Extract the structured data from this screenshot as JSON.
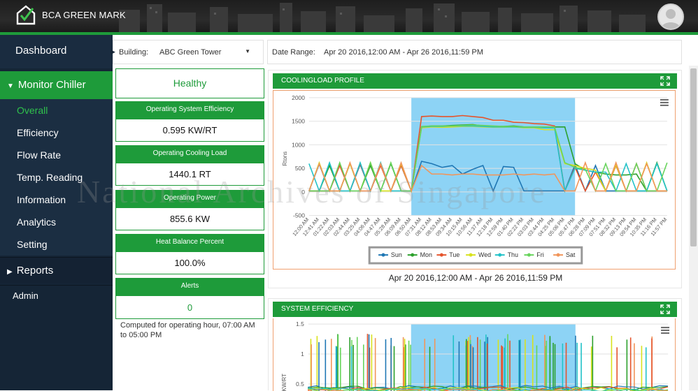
{
  "app": {
    "brand": "BCA GREEN MARK"
  },
  "sidebar": {
    "dashboard": "Dashboard",
    "monitor": "Monitor Chiller",
    "items": [
      {
        "label": "Overall",
        "active": true
      },
      {
        "label": "Efficiency"
      },
      {
        "label": "Flow Rate"
      },
      {
        "label": "Temp. Reading"
      },
      {
        "label": "Information"
      },
      {
        "label": "Analytics"
      },
      {
        "label": "Setting"
      }
    ],
    "reports": "Reports",
    "admin": "Admin"
  },
  "filters": {
    "building_label": "Building:",
    "building_value": "ABC Green Tower",
    "date_label": "Date Range:",
    "date_value": "Apr 20 2016,12:00 AM - Apr 26 2016,11:59 PM"
  },
  "kpi": {
    "status": "Healthy",
    "efficiency_label": "Operating System Efficiency",
    "efficiency_value": "0.595 KW/RT",
    "cooling_label": "Operating Cooling Load",
    "cooling_value": "1440.1 RT",
    "power_label": "Operating Power",
    "power_value": "855.6 KW",
    "heat_label": "Heat Balance Percent",
    "heat_value": "100.0%",
    "alerts_label": "Alerts",
    "alerts_value": "0",
    "note": "Computed for operating hour, 07:00 AM to 05:00 PM"
  },
  "watermark": "National Archives of Singapore",
  "chart_data": [
    {
      "type": "line",
      "title": "COOLINGLOAD PROFILE",
      "ylabel": "Rtons",
      "ylim": [
        -500,
        2000
      ],
      "yticks": [
        "2000",
        "1500",
        "1000",
        "500",
        "0",
        "-500"
      ],
      "xticks": [
        "12:00 AM",
        "12:41 AM",
        "01:22 AM",
        "02:03 AM",
        "02:44 AM",
        "03:25 AM",
        "04:06 AM",
        "04:47 AM",
        "05:28 AM",
        "06:09 AM",
        "06:50 AM",
        "07:31 AM",
        "08:12 AM",
        "08:53 AM",
        "09:34 AM",
        "10:15 AM",
        "10:56 AM",
        "11:37 AM",
        "12:18 PM",
        "12:59 PM",
        "01:40 PM",
        "02:22 PM",
        "03:03 PM",
        "03:44 PM",
        "04:25 PM",
        "05:06 PM",
        "05:47 PM",
        "06:28 PM",
        "07:09 PM",
        "07:51 PM",
        "08:32 PM",
        "09:13 PM",
        "09:54 PM",
        "10:35 PM",
        "11:16 PM",
        "11:57 PM"
      ],
      "highlight_band": [
        "06:50 AM",
        "05:47 PM"
      ],
      "highlight_color": "#8dd3f5",
      "legend_position": "bottom",
      "footer": "Apr 20 2016,12:00 AM - Apr 26 2016,11:59 PM",
      "series": [
        {
          "name": "Sun",
          "color": "#1f77b4",
          "values": [
            20,
            590,
            20,
            580,
            20,
            580,
            20,
            590,
            20,
            560,
            20,
            650,
            600,
            520,
            560,
            380,
            480,
            560,
            20,
            540,
            520,
            20,
            20,
            20,
            20,
            20,
            580,
            20,
            560,
            20,
            20,
            20,
            20,
            20,
            20,
            20
          ]
        },
        {
          "name": "Mon",
          "color": "#2ca02c",
          "values": [
            20,
            20,
            560,
            20,
            600,
            20,
            560,
            20,
            600,
            20,
            20,
            1380,
            1400,
            1400,
            1410,
            1420,
            1430,
            1400,
            1390,
            1390,
            1400,
            1380,
            1380,
            1380,
            1380,
            1380,
            600,
            460,
            420,
            380,
            360,
            360,
            380,
            20,
            620,
            20
          ]
        },
        {
          "name": "Tue",
          "color": "#e5542c",
          "values": [
            20,
            20,
            20,
            560,
            20,
            600,
            20,
            560,
            20,
            560,
            20,
            1600,
            1610,
            1600,
            1600,
            1620,
            1600,
            1580,
            1520,
            1520,
            1480,
            1470,
            1450,
            1440,
            1400,
            20,
            520,
            20,
            420,
            20,
            560,
            20,
            600,
            20,
            20,
            20
          ]
        },
        {
          "name": "Wed",
          "color": "#d8e21c",
          "values": [
            20,
            620,
            20,
            20,
            600,
            20,
            620,
            20,
            20,
            600,
            20,
            1360,
            1380,
            1370,
            1380,
            1390,
            1390,
            1380,
            1370,
            1370,
            1380,
            1360,
            1360,
            1320,
            1320,
            600,
            560,
            500,
            460,
            20,
            580,
            20,
            20,
            620,
            20,
            20
          ]
        },
        {
          "name": "Thu",
          "color": "#22c2c8",
          "values": [
            600,
            20,
            620,
            20,
            20,
            620,
            20,
            620,
            20,
            20,
            20,
            1380,
            1390,
            1390,
            1400,
            1400,
            1400,
            1390,
            1380,
            1380,
            1380,
            1370,
            1370,
            1360,
            1360,
            20,
            500,
            460,
            420,
            420,
            20,
            600,
            20,
            20,
            600,
            20
          ]
        },
        {
          "name": "Fri",
          "color": "#68d45c",
          "values": [
            20,
            20,
            20,
            620,
            20,
            20,
            620,
            20,
            620,
            20,
            20,
            1390,
            1400,
            1400,
            1400,
            1410,
            1420,
            1410,
            1400,
            1390,
            1390,
            1380,
            1380,
            1380,
            1380,
            620,
            520,
            480,
            20,
            600,
            20,
            20,
            600,
            20,
            20,
            620
          ]
        },
        {
          "name": "Sat",
          "color": "#f1955a",
          "values": [
            20,
            600,
            20,
            20,
            620,
            20,
            20,
            600,
            20,
            620,
            20,
            560,
            380,
            380,
            360,
            380,
            380,
            360,
            360,
            360,
            380,
            360,
            380,
            360,
            380,
            20,
            20,
            620,
            20,
            20,
            620,
            20,
            20,
            600,
            20,
            20
          ]
        }
      ]
    },
    {
      "type": "line",
      "title": "SYSTEM EFFICIENCY",
      "ylabel": "KW/RT",
      "yticks": [
        "1.5",
        "1",
        "0.5"
      ],
      "highlight_band": [
        "06:50 AM",
        "05:47 PM"
      ]
    }
  ]
}
